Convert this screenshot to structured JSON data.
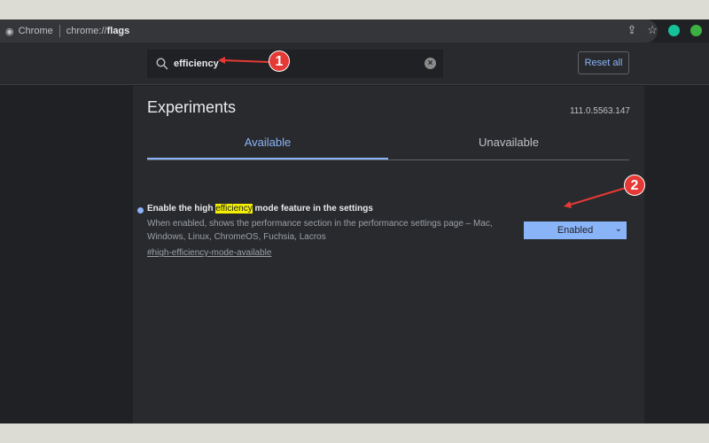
{
  "browser": {
    "app_name": "Chrome",
    "url_prefix": "chrome://",
    "url_bold": "flags"
  },
  "search": {
    "value": "efficiency"
  },
  "header": {
    "reset_label": "Reset all"
  },
  "page": {
    "title": "Experiments",
    "version": "111.0.5563.147"
  },
  "tabs": [
    {
      "label": "Available",
      "active": true
    },
    {
      "label": "Unavailable",
      "active": false
    }
  ],
  "experiment": {
    "title_pre": "Enable the high ",
    "title_highlight": "efficiency",
    "title_post": " mode feature in the settings",
    "description": "When enabled, shows the performance section in the performance settings page – Mac, Windows, Linux, ChromeOS, Fuchsia, Lacros",
    "link": "#high-efficiency-mode-available",
    "selected": "Enabled"
  },
  "annotations": [
    "1",
    "2"
  ],
  "colors": {
    "accent": "#8ab4f8",
    "highlight": "#f4f000",
    "badge": "#e53935"
  }
}
